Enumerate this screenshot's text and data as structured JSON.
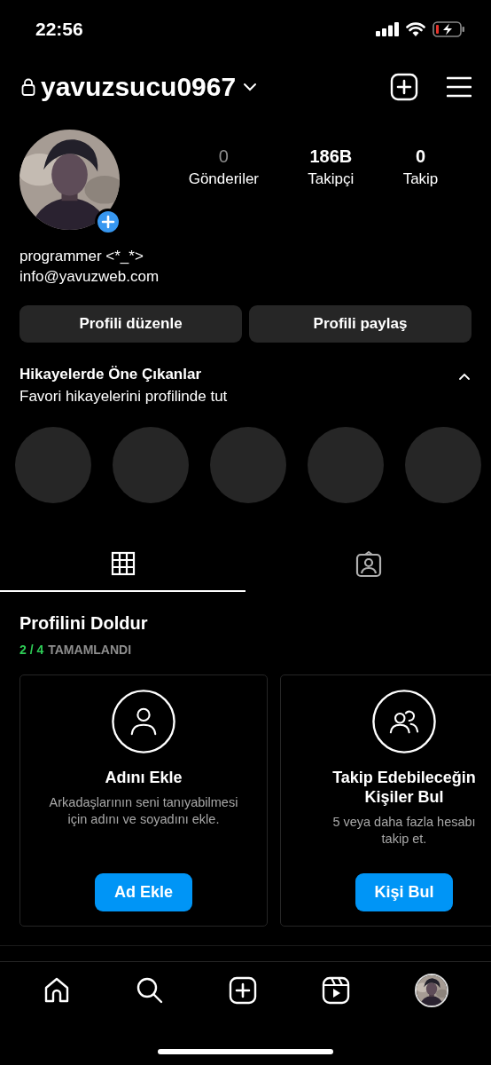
{
  "status_bar": {
    "time": "22:56"
  },
  "header": {
    "username": "yavuzsucu0967"
  },
  "profile": {
    "avatar": {
      "kind": "picture"
    },
    "stats": [
      {
        "value": "0",
        "label": "Gönderiler",
        "muted": true
      },
      {
        "value": "186B",
        "label": "Takipçi",
        "muted": false
      },
      {
        "value": "0",
        "label": "Takip",
        "muted": false
      }
    ],
    "bio": [
      "programmer <*_*>",
      "info@yavuzweb.com"
    ]
  },
  "buttons": [
    "Profili düzenle",
    "Profili paylaş"
  ],
  "highlights": {
    "title": "Hikayelerde Öne Çıkanlar",
    "subtitle": "Favori hikayelerini profilinde tut",
    "expanded": true,
    "items": [
      {
        "kind": "empty"
      },
      {
        "kind": "empty"
      },
      {
        "kind": "empty"
      },
      {
        "kind": "empty"
      },
      {
        "kind": "empty"
      }
    ]
  },
  "tabs": [
    {
      "kind": "grid",
      "selected": true
    },
    {
      "kind": "tagged",
      "selected": false
    }
  ],
  "complete_profile": {
    "title": "Profilini Doldur",
    "progress": "2 / 4",
    "progress_label": "TAMAMLANDI",
    "cards": [
      {
        "kind": "person",
        "title": "Adını Ekle",
        "text": [
          "Arkadaşlarının seni tanıyabilmesi",
          "için adını ve soyadını ekle."
        ],
        "button": "Ad Ekle"
      },
      {
        "kind": "people",
        "title": "Takip Edebileceğin Kişiler Bul",
        "text": [
          "5 veya daha fazla hesabı",
          "takip et."
        ],
        "button": "Kişi Bul"
      }
    ]
  },
  "bottom_nav": [
    {
      "kind": "home"
    },
    {
      "kind": "search"
    },
    {
      "kind": "create"
    },
    {
      "kind": "reels"
    },
    {
      "kind": "profile"
    }
  ]
}
